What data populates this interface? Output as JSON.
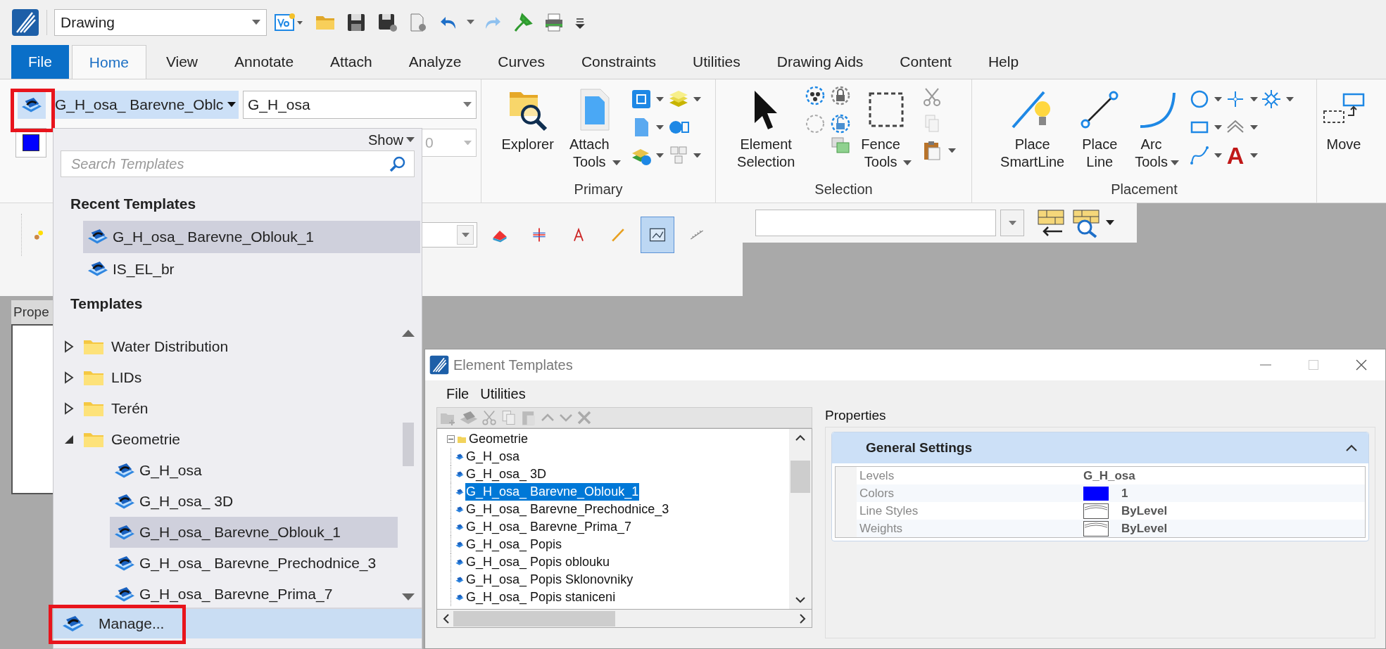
{
  "quick_access": {
    "workflow": "Drawing"
  },
  "tabs": [
    {
      "label": "File",
      "kind": "backstage",
      "selected": false
    },
    {
      "label": "Home",
      "kind": "tab",
      "selected": true
    },
    {
      "label": "View",
      "kind": "tab",
      "selected": false
    },
    {
      "label": "Annotate",
      "kind": "tab",
      "selected": false
    },
    {
      "label": "Attach",
      "kind": "tab",
      "selected": false
    },
    {
      "label": "Analyze",
      "kind": "tab",
      "selected": false
    },
    {
      "label": "Curves",
      "kind": "tab",
      "selected": false
    },
    {
      "label": "Constraints",
      "kind": "tab",
      "selected": false
    },
    {
      "label": "Utilities",
      "kind": "tab",
      "selected": false
    },
    {
      "label": "Drawing Aids",
      "kind": "tab",
      "selected": false
    },
    {
      "label": "Content",
      "kind": "tab",
      "selected": false
    },
    {
      "label": "Help",
      "kind": "tab",
      "selected": false
    }
  ],
  "ribbon": {
    "attributes": {
      "template": "G_H_osa_ Barevne_Oblc",
      "level": "G_H_osa",
      "color": "#0000ff",
      "weight": "0"
    },
    "primary": {
      "label": "Primary",
      "explorer": "Explorer",
      "attach": "Attach Tools"
    },
    "selection": {
      "label": "Selection",
      "element_selection": "Element Selection",
      "fence": "Fence Tools"
    },
    "placement": {
      "label": "Placement",
      "smartline": "Place SmartLine",
      "line": "Place Line",
      "arc": "Arc Tools",
      "text_glyph": "A"
    },
    "manipulate": {
      "move": "Move"
    }
  },
  "toolbar": {
    "buttons": [
      {
        "selected": false
      },
      {
        "selected": false
      },
      {
        "selected": false
      },
      {
        "selected": false
      },
      {
        "selected": false
      },
      {
        "selected": true
      },
      {
        "selected": false
      }
    ]
  },
  "side_panel": {
    "title": "Prope"
  },
  "template_popup": {
    "show": "Show",
    "search_placeholder": "Search Templates",
    "recent_heading": "Recent Templates",
    "recent": [
      {
        "label": "G_H_osa_ Barevne_Oblouk_1",
        "selected": true
      },
      {
        "label": "IS_EL_br",
        "selected": false
      }
    ],
    "templates_heading": "Templates",
    "tree": [
      {
        "label": "Water Distribution",
        "expanded": false
      },
      {
        "label": "LIDs",
        "expanded": false
      },
      {
        "label": "Terén",
        "expanded": false
      },
      {
        "label": "Geometrie",
        "expanded": true,
        "children": [
          {
            "label": "G_H_osa",
            "selected": false
          },
          {
            "label": "G_H_osa_ 3D",
            "selected": false
          },
          {
            "label": "G_H_osa_ Barevne_Oblouk_1",
            "selected": true
          },
          {
            "label": "G_H_osa_ Barevne_Prechodnice_3",
            "selected": false
          },
          {
            "label": "G_H_osa_ Barevne_Prima_7",
            "selected": false
          }
        ]
      }
    ],
    "manage": "Manage..."
  },
  "dialog": {
    "title": "Element Templates",
    "menu": [
      "File",
      "Utilities"
    ],
    "tree": {
      "label": "Geometrie",
      "expanded": true,
      "children": [
        {
          "label": "G_H_osa",
          "selected": false
        },
        {
          "label": "G_H_osa_ 3D",
          "selected": false
        },
        {
          "label": "G_H_osa_ Barevne_Oblouk_1",
          "selected": true
        },
        {
          "label": "G_H_osa_ Barevne_Prechodnice_3",
          "selected": false
        },
        {
          "label": "G_H_osa_ Barevne_Prima_7",
          "selected": false
        },
        {
          "label": "G_H_osa_ Popis",
          "selected": false
        },
        {
          "label": "G_H_osa_ Popis oblouku",
          "selected": false
        },
        {
          "label": "G_H_osa_ Popis Sklonovniky",
          "selected": false
        },
        {
          "label": "G_H_osa_ Popis staniceni",
          "selected": false
        }
      ]
    },
    "properties": {
      "title": "Properties",
      "section": "General Settings",
      "expanded": true,
      "rows": [
        {
          "label": "Levels",
          "value": "G_H_osa",
          "kind": "text"
        },
        {
          "label": "Colors",
          "value": "1",
          "kind": "color",
          "color": "#0000ff"
        },
        {
          "label": "Line Styles",
          "value": "ByLevel",
          "kind": "style"
        },
        {
          "label": "Weights",
          "value": "ByLevel",
          "kind": "style"
        }
      ]
    }
  }
}
